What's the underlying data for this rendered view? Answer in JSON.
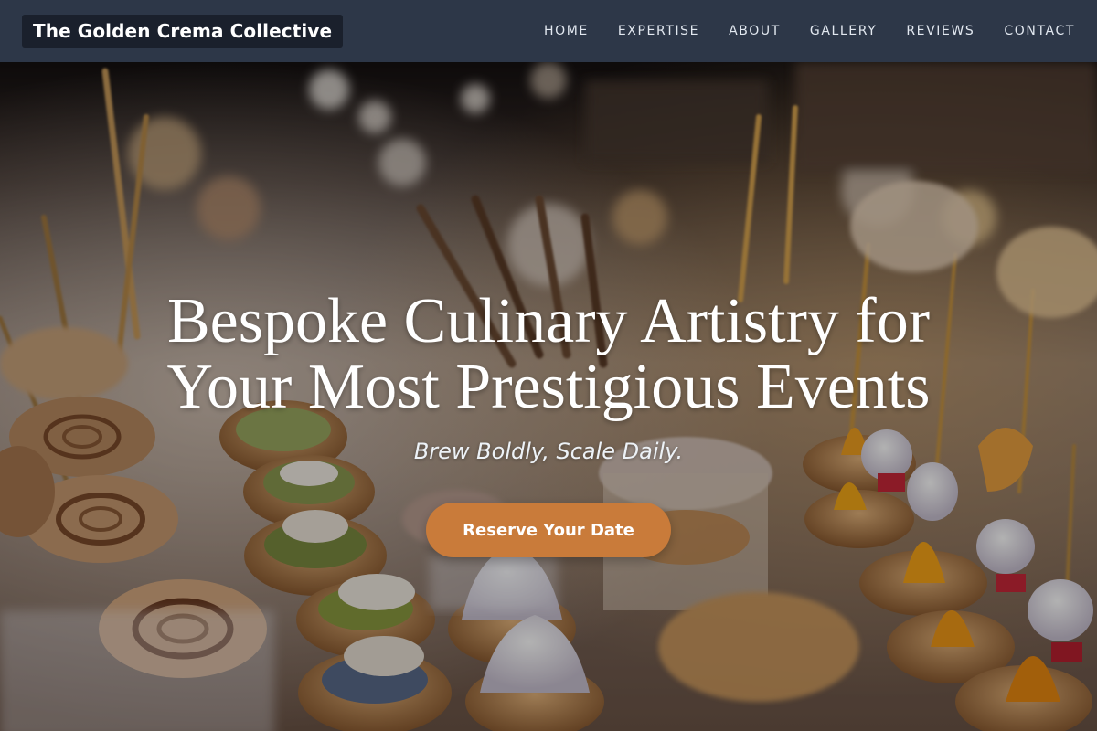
{
  "nav": {
    "brand": "The Golden Crema Collective",
    "links": [
      {
        "label": "HOME"
      },
      {
        "label": "EXPERTISE"
      },
      {
        "label": "ABOUT"
      },
      {
        "label": "GALLERY"
      },
      {
        "label": "REVIEWS"
      },
      {
        "label": "CONTACT"
      }
    ]
  },
  "hero": {
    "title": "Bespoke Culinary Artistry for Your Most Prestigious Events",
    "tagline": "Brew Boldly, Scale Daily.",
    "cta_label": "Reserve Your Date",
    "image_alt": "Catering table with canapés, tartlets and pinwheel wraps"
  },
  "colors": {
    "navbar": "#2d3748",
    "brand_bg": "#1a202c",
    "accent": "#c97b3a",
    "text_light": "#ffffff"
  }
}
